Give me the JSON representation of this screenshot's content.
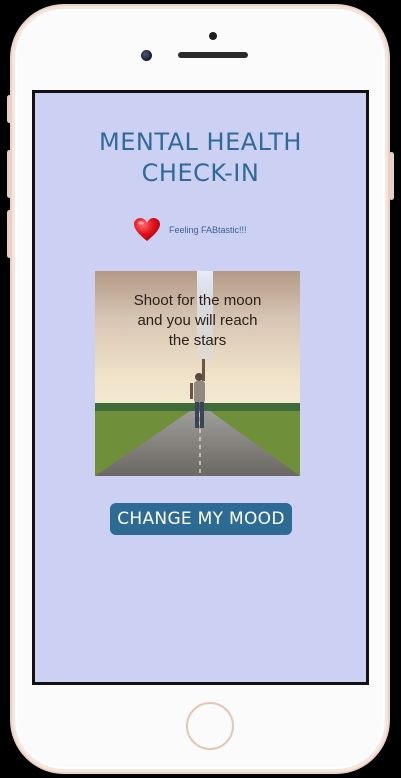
{
  "screen": {
    "title": "MENTAL HEALTH\nCHECK-IN",
    "mood_text": "Feeling FABtastic!!!",
    "quote": "Shoot for the moon\nand you will reach\nthe stars",
    "change_mood_label": "CHANGE MY MOOD"
  },
  "colors": {
    "screen_bg": "#ccd0f3",
    "title": "#2f6a9a",
    "button_bg": "#2d6a94",
    "heart": "#e0121b"
  }
}
